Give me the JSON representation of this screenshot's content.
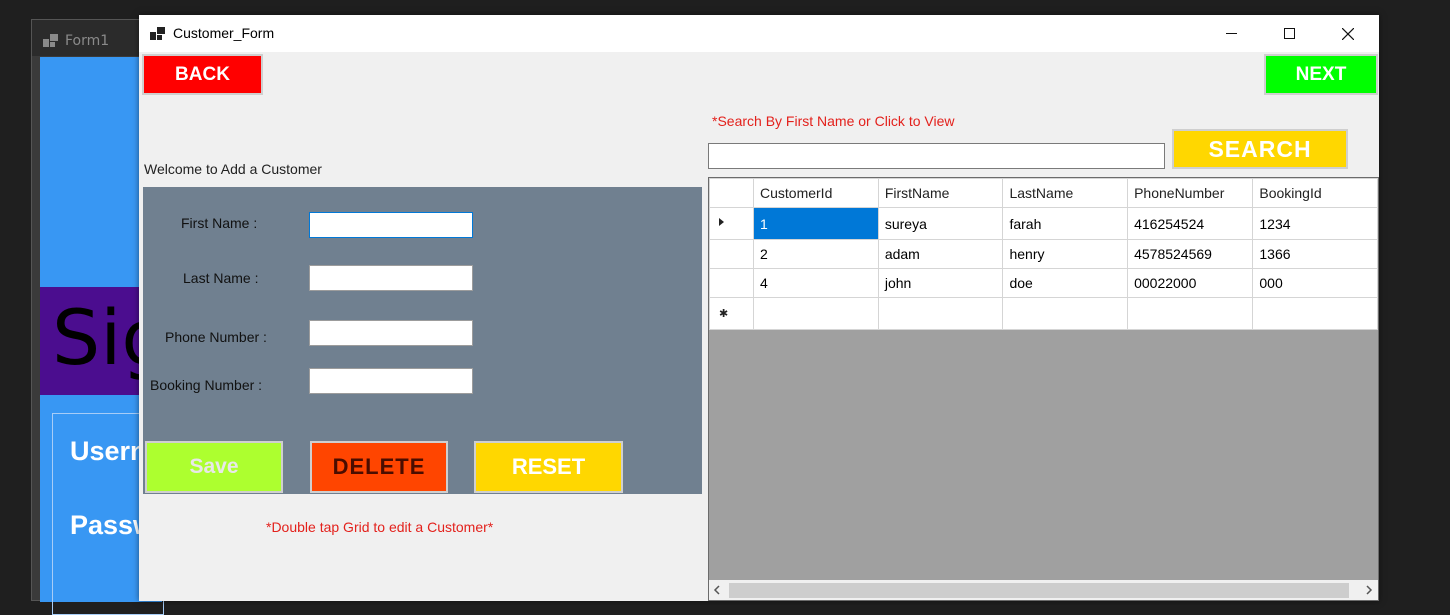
{
  "background_window": {
    "title": "Form1",
    "sign_text": "Sig",
    "username_label": "Usern",
    "password_label": "Passw"
  },
  "window": {
    "title": "Customer_Form",
    "minimize_glyph": "—",
    "maximize_glyph": "☐",
    "close_glyph": "✕"
  },
  "nav": {
    "back_label": "BACK",
    "next_label": "NEXT"
  },
  "search": {
    "hint": "*Search By First Name or Click to View",
    "value": "",
    "button_label": "SEARCH"
  },
  "form": {
    "welcome": "Welcome to Add a Customer",
    "first_name_label": "First Name :",
    "last_name_label": "Last Name :",
    "phone_label": "Phone Number :",
    "booking_label": "Booking Number :",
    "first_name_value": "",
    "last_name_value": "",
    "phone_value": "",
    "booking_value": "",
    "save_label": "Save",
    "delete_label": "DELETE",
    "reset_label": "RESET",
    "edit_hint": "*Double tap Grid to edit a Customer*"
  },
  "grid": {
    "columns": [
      "CustomerId",
      "FirstName",
      "LastName",
      "PhoneNumber",
      "BookingId"
    ],
    "rows": [
      [
        "1",
        "sureya",
        "farah",
        "416254524",
        "1234"
      ],
      [
        "2",
        "adam",
        "henry",
        "4578524569",
        "1366"
      ],
      [
        "4",
        "john",
        "doe",
        "00022000",
        "000"
      ]
    ],
    "current_row_glyph": "▶",
    "new_row_glyph": "*",
    "scroll_left": "<",
    "scroll_right": ">"
  },
  "colors": {
    "back": "#ff0000",
    "next": "#00ff00",
    "search": "#ffd700",
    "save": "#adff2f",
    "delete": "#ff4500",
    "reset": "#ffd700",
    "form_panel": "#708090",
    "hint_text": "#e3211c",
    "selection": "#0078d7"
  }
}
